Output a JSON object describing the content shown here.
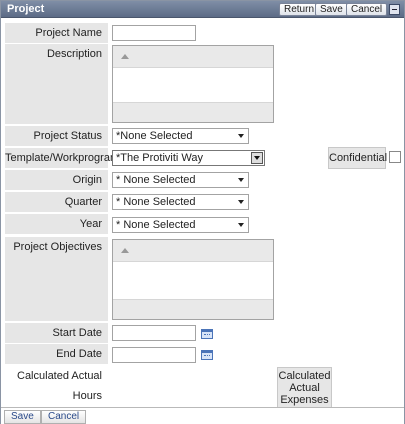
{
  "window": {
    "title": "Project",
    "return_label": "Return",
    "save_label": "Save",
    "cancel_label": "Cancel"
  },
  "form": {
    "project_name_label": "Project Name",
    "project_name_value": "",
    "description_label": "Description",
    "project_status_label": "Project Status",
    "project_status_value": "*None Selected",
    "template_label": "Template/Workprogram",
    "template_value": "*The Protiviti Way",
    "confidential_label": "Confidential",
    "origin_label": "Origin",
    "origin_value": "* None Selected",
    "quarter_label": "Quarter",
    "quarter_value": "* None Selected",
    "year_label": "Year",
    "year_value": "* None Selected",
    "objectives_label": "Project Objectives",
    "start_date_label": "Start Date",
    "start_date_value": "",
    "end_date_label": "End Date",
    "end_date_value": "",
    "calc_hours_label": "Calculated Actual Hours",
    "calc_expenses_line1": "Calculated",
    "calc_expenses_line2": "Actual",
    "calc_expenses_line3": "Expenses"
  },
  "footer": {
    "save_label": "Save",
    "cancel_label": "Cancel"
  },
  "icons": {
    "collapse": "minimize-icon",
    "calendar": "calendar-icon",
    "rte_toggle": "chevron-up-icon"
  }
}
